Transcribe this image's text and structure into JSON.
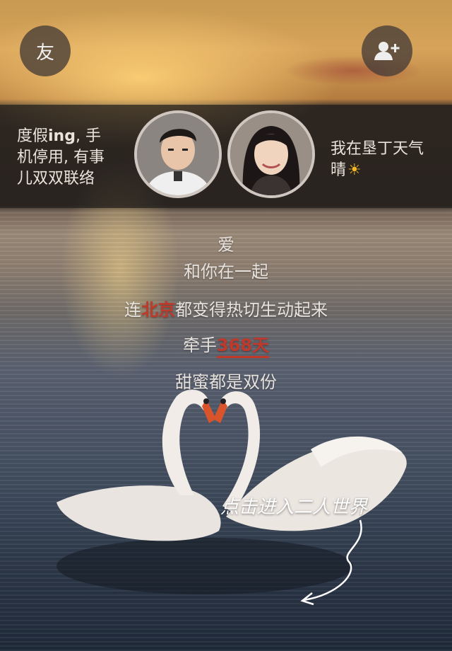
{
  "top_bar": {
    "friends_button_label": "友",
    "add_friend_icon": "add-user-icon"
  },
  "profile_band": {
    "left_status": {
      "line1_prefix": "度假",
      "line1_bold": "ing",
      "line1_suffix": ", 手",
      "line2": "机停用, 有事",
      "line3": "儿双双联络"
    },
    "right_status": {
      "line1": "我在垦丁天气",
      "line2": "晴",
      "weather_icon": "sun-icon"
    }
  },
  "love_message": {
    "line1": "爱",
    "line2": "和你在一起",
    "line3_prefix": "连",
    "line3_highlight": "北京",
    "line3_suffix": "都变得热切生动起来",
    "line4_prefix": "牵手",
    "line4_highlight": "368天",
    "line5": "甜蜜都是双份"
  },
  "cta": {
    "label": "点击进入二人世界"
  },
  "colors": {
    "highlight": "#c0392b",
    "band": "#231e1c",
    "text": "#e7e2dd"
  }
}
